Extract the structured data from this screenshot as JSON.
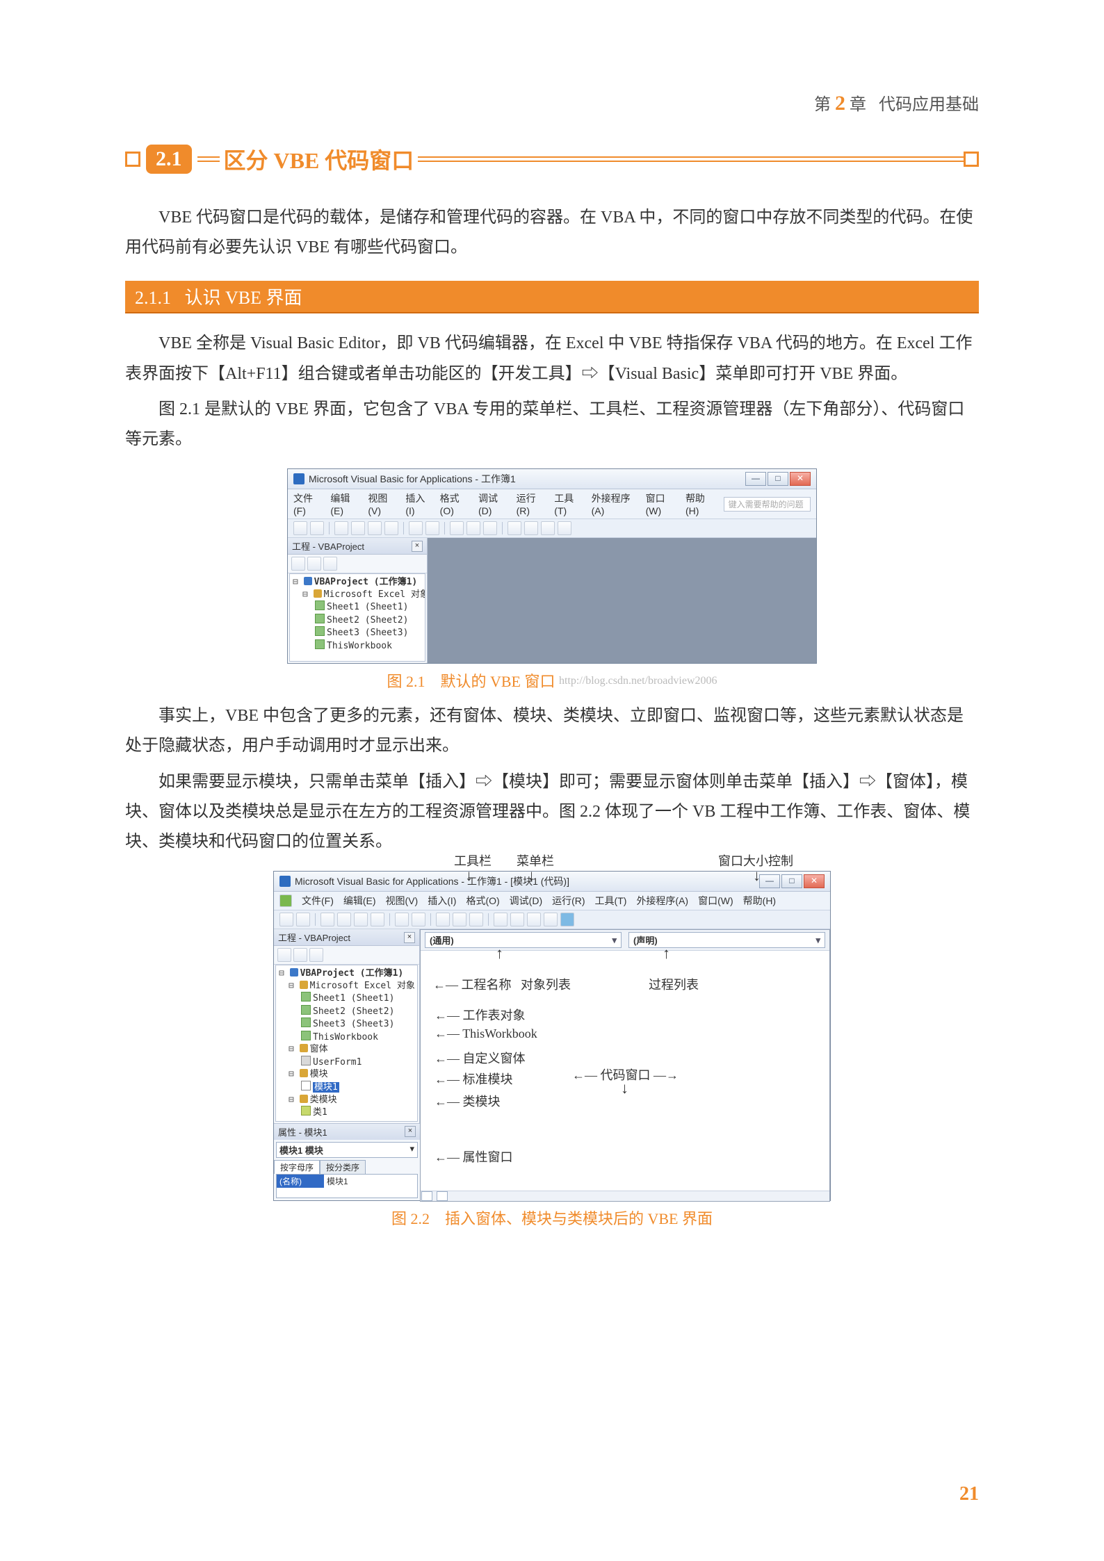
{
  "chapter": {
    "prefix": "第",
    "num": "2",
    "suffix": "章",
    "title": "代码应用基础"
  },
  "section": {
    "num": "2.1",
    "title": "区分 VBE 代码窗口"
  },
  "intro_p1": "VBE 代码窗口是代码的载体，是储存和管理代码的容器。在 VBA 中，不同的窗口中存放不同类型的代码。在使用代码前有必要先认识 VBE 有哪些代码窗口。",
  "subsection": {
    "num": "2.1.1",
    "title": "认识 VBE 界面"
  },
  "p2": "VBE 全称是 Visual Basic Editor，即 VB 代码编辑器，在 Excel 中 VBE 特指保存 VBA 代码的地方。在 Excel 工作表界面按下【Alt+F11】组合键或者单击功能区的【开发工具】⇨【Visual Basic】菜单即可打开 VBE 界面。",
  "p3": "图 2.1 是默认的 VBE 界面，它包含了 VBA 专用的菜单栏、工具栏、工程资源管理器（左下角部分）、代码窗口等元素。",
  "fig1": {
    "title": "Microsoft Visual Basic for Applications - 工作簿1",
    "menus": [
      "文件(F)",
      "编辑(E)",
      "视图(V)",
      "插入(I)",
      "格式(O)",
      "调试(D)",
      "运行(R)",
      "工具(T)",
      "外接程序(A)",
      "窗口(W)",
      "帮助(H)"
    ],
    "help_search": "键入需要帮助的问题",
    "project_title": "工程 - VBAProject",
    "tree_root": "VBAProject (工作簿1)",
    "tree_folder": "Microsoft Excel 对象",
    "sheets": [
      "Sheet1 (Sheet1)",
      "Sheet2 (Sheet2)",
      "Sheet3 (Sheet3)",
      "ThisWorkbook"
    ],
    "caption": "图 2.1　默认的 VBE 窗口",
    "watermark": "http://blog.csdn.net/broadview2006"
  },
  "p4": "事实上，VBE 中包含了更多的元素，还有窗体、模块、类模块、立即窗口、监视窗口等，这些元素默认状态是处于隐藏状态，用户手动调用时才显示出来。",
  "p5": "如果需要显示模块，只需单击菜单【插入】⇨【模块】即可；需要显示窗体则单击菜单【插入】⇨【窗体】，模块、窗体以及类模块总是显示在左方的工程资源管理器中。图 2.2 体现了一个 VB 工程中工作簿、工作表、窗体、模块、类模块和代码窗口的位置关系。",
  "fig2": {
    "title": "Microsoft Visual Basic for Applications - 工作簿1 - [模块1 (代码)]",
    "menus": [
      "文件(F)",
      "编辑(E)",
      "视图(V)",
      "插入(I)",
      "格式(O)",
      "调试(D)",
      "运行(R)",
      "工具(T)",
      "外接程序(A)",
      "窗口(W)",
      "帮助(H)"
    ],
    "project_title": "工程 - VBAProject",
    "tree_root": "VBAProject (工作簿1)",
    "tree_folder": "Microsoft Excel 对象",
    "sheets": [
      "Sheet1 (Sheet1)",
      "Sheet2 (Sheet2)",
      "Sheet3 (Sheet3)",
      "ThisWorkbook"
    ],
    "forms_folder": "窗体",
    "forms": [
      "UserForm1"
    ],
    "modules_folder": "模块",
    "modules": [
      "模块1"
    ],
    "classes_folder": "类模块",
    "classes": [
      "类1"
    ],
    "combo_left": "(通用)",
    "combo_right": "(声明)",
    "prop_title": "属性 - 模块1",
    "prop_combo": "模块1 模块",
    "prop_tab1": "按字母序",
    "prop_tab2": "按分类序",
    "prop_key": "(名称)",
    "prop_val": "模块1",
    "annotations": {
      "toolbar": "工具栏",
      "menubar": "菜单栏",
      "winctrl": "窗口大小控制",
      "projname": "工程名称",
      "objlist": "对象列表",
      "proclist": "过程列表",
      "sheetobj": "工作表对象",
      "thiswb": "ThisWorkbook",
      "userform": "自定义窗体",
      "stdmod": "标准模块",
      "codewin": "代码窗口",
      "clsmod": "类模块",
      "propwin": "属性窗口"
    },
    "caption": "图 2.2　插入窗体、模块与类模块后的 VBE 界面"
  },
  "page_num": "21"
}
